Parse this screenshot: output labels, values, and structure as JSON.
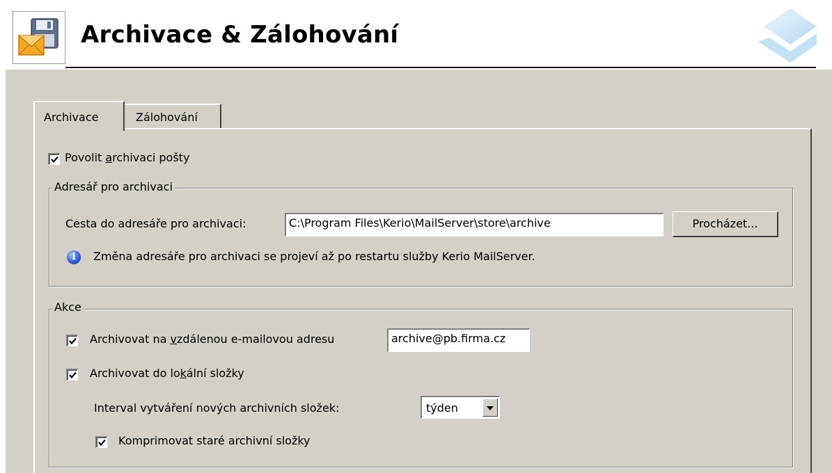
{
  "header": {
    "title": "Archivace & Zálohování",
    "icon": "archive-backup-icon",
    "logo": "kerio-logo-icon"
  },
  "tabs": [
    {
      "label": "Archivace",
      "active": true
    },
    {
      "label": "Zálohování",
      "active": false
    }
  ],
  "enable_archiving": {
    "label_before": "Povolit ",
    "label_accel": "a",
    "label_after": "rchivaci pošty",
    "checked": true
  },
  "directory_group": {
    "legend": "Adresář pro archivaci",
    "path_label": "Cesta do adresáře pro archivaci:",
    "path_value": "C:\\Program Files\\Kerio\\MailServer\\store\\archive",
    "browse_label": "Procházet...",
    "info_text": "Změna adresáře pro archivaci se projeví až po restartu služby Kerio MailServer."
  },
  "actions_group": {
    "legend": "Akce",
    "remote_before": "Archivovat na ",
    "remote_accel": "v",
    "remote_after": "zdálenou e-mailovou adresu",
    "remote_checked": true,
    "remote_address": "archive@pb.firma.cz",
    "local_before": "Archivovat do lo",
    "local_accel": "k",
    "local_after": "ální složky",
    "local_checked": true,
    "interval_label": "Interval vytváření nových archivních složek:",
    "interval_value": "týden",
    "compress_label": "Komprimovat staré archivní složky",
    "compress_checked": true
  },
  "colors": {
    "panel_bg": "#d4d0c8",
    "title": "#000000",
    "info_blue": "#2b5bd7"
  }
}
